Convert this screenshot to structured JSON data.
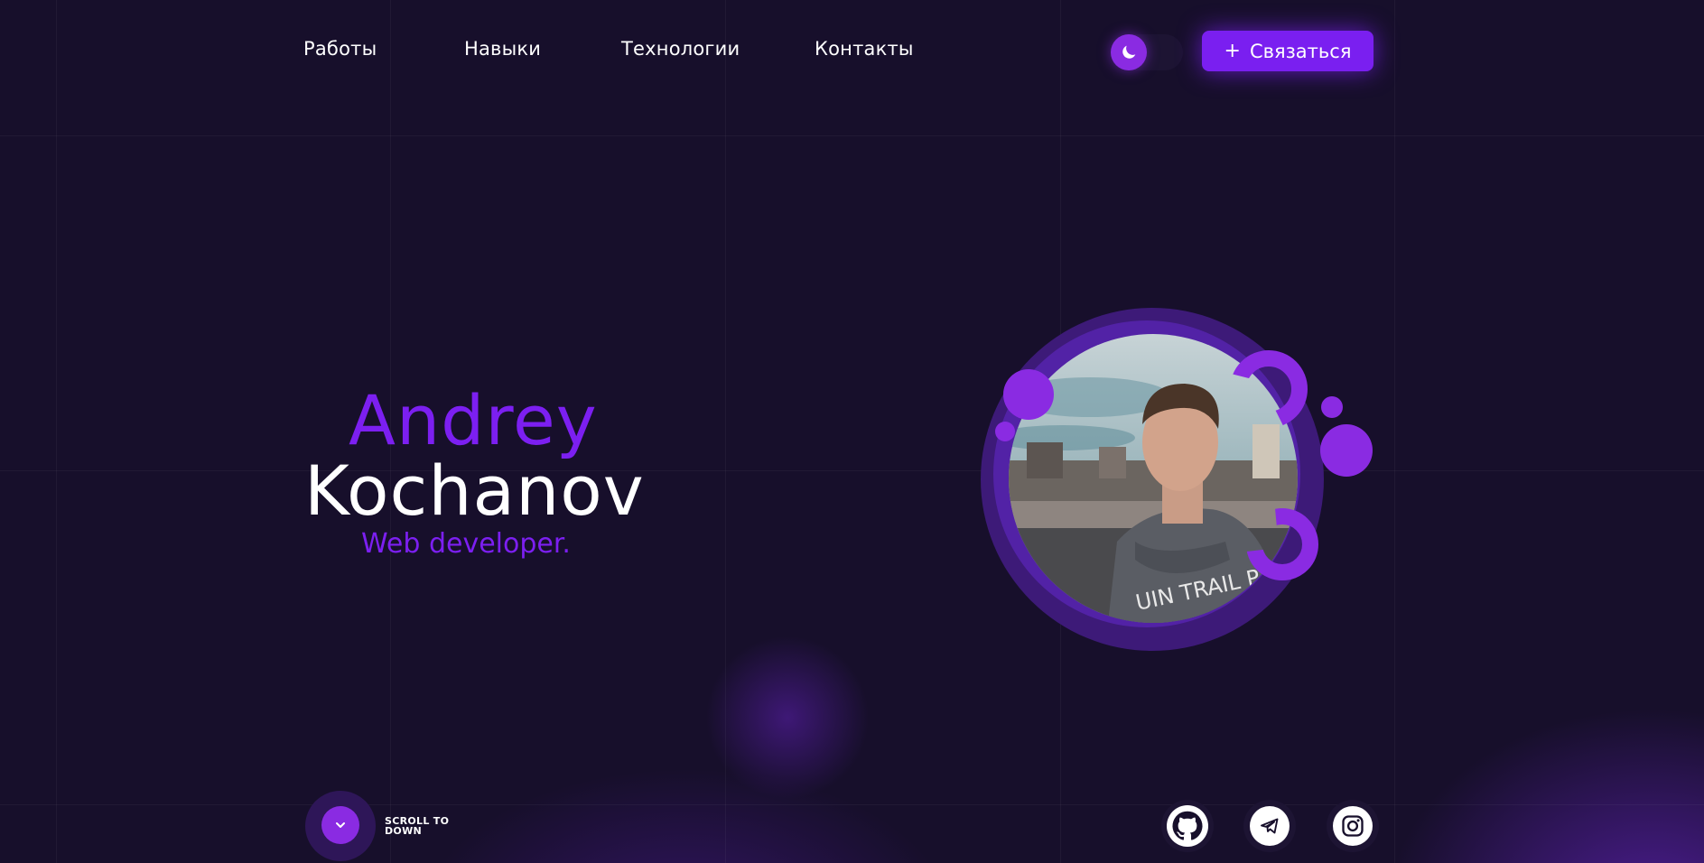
{
  "nav": {
    "links": [
      {
        "label": "Работы"
      },
      {
        "label": "Навыки"
      },
      {
        "label": "Технологии"
      },
      {
        "label": "Контакты"
      }
    ],
    "theme_toggle_icon": "moon-icon",
    "contact_button": {
      "icon": "+",
      "label": "Связаться"
    }
  },
  "hero": {
    "first_name": "Andrey",
    "last_name": "Kochanov",
    "role": "Web developer."
  },
  "footer": {
    "scroll_icon": "chevron-down-icon",
    "scroll_label_line1": "SCROLL TO",
    "scroll_label_line2": "DOWN",
    "socials": [
      {
        "icon": "github-icon"
      },
      {
        "icon": "telegram-icon"
      },
      {
        "icon": "instagram-icon"
      }
    ]
  },
  "colors": {
    "background": "#170f2b",
    "accent": "#7c1ff1",
    "accent_light": "#8a2be2",
    "text": "#ffffff"
  }
}
